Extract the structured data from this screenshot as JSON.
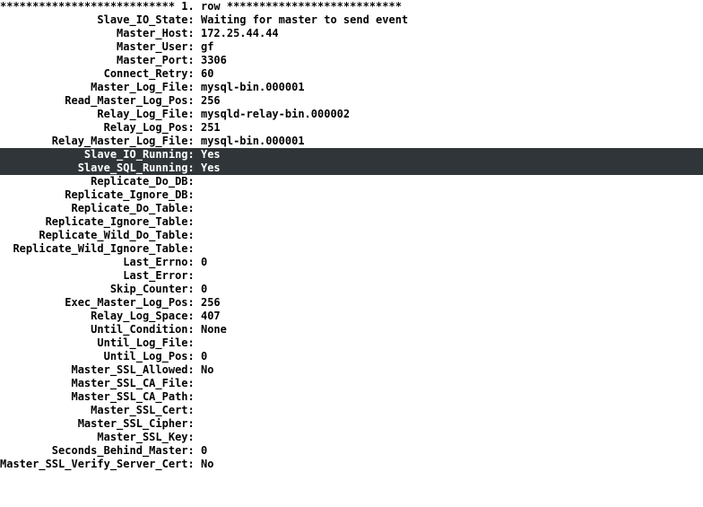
{
  "header": "*************************** 1. row ***************************",
  "labelWidth": 29,
  "highlight": [
    "Slave_IO_Running",
    "Slave_SQL_Running"
  ],
  "fields": [
    {
      "k": "Slave_IO_State",
      "v": "Waiting for master to send event"
    },
    {
      "k": "Master_Host",
      "v": "172.25.44.44"
    },
    {
      "k": "Master_User",
      "v": "gf"
    },
    {
      "k": "Master_Port",
      "v": "3306"
    },
    {
      "k": "Connect_Retry",
      "v": "60"
    },
    {
      "k": "Master_Log_File",
      "v": "mysql-bin.000001"
    },
    {
      "k": "Read_Master_Log_Pos",
      "v": "256"
    },
    {
      "k": "Relay_Log_File",
      "v": "mysqld-relay-bin.000002"
    },
    {
      "k": "Relay_Log_Pos",
      "v": "251"
    },
    {
      "k": "Relay_Master_Log_File",
      "v": "mysql-bin.000001"
    },
    {
      "k": "Slave_IO_Running",
      "v": "Yes"
    },
    {
      "k": "Slave_SQL_Running",
      "v": "Yes"
    },
    {
      "k": "Replicate_Do_DB",
      "v": ""
    },
    {
      "k": "Replicate_Ignore_DB",
      "v": ""
    },
    {
      "k": "Replicate_Do_Table",
      "v": ""
    },
    {
      "k": "Replicate_Ignore_Table",
      "v": ""
    },
    {
      "k": "Replicate_Wild_Do_Table",
      "v": ""
    },
    {
      "k": "Replicate_Wild_Ignore_Table",
      "v": ""
    },
    {
      "k": "Last_Errno",
      "v": "0"
    },
    {
      "k": "Last_Error",
      "v": ""
    },
    {
      "k": "Skip_Counter",
      "v": "0"
    },
    {
      "k": "Exec_Master_Log_Pos",
      "v": "256"
    },
    {
      "k": "Relay_Log_Space",
      "v": "407"
    },
    {
      "k": "Until_Condition",
      "v": "None"
    },
    {
      "k": "Until_Log_File",
      "v": ""
    },
    {
      "k": "Until_Log_Pos",
      "v": "0"
    },
    {
      "k": "Master_SSL_Allowed",
      "v": "No"
    },
    {
      "k": "Master_SSL_CA_File",
      "v": ""
    },
    {
      "k": "Master_SSL_CA_Path",
      "v": ""
    },
    {
      "k": "Master_SSL_Cert",
      "v": ""
    },
    {
      "k": "Master_SSL_Cipher",
      "v": ""
    },
    {
      "k": "Master_SSL_Key",
      "v": ""
    },
    {
      "k": "Seconds_Behind_Master",
      "v": "0"
    },
    {
      "k": "Master_SSL_Verify_Server_Cert",
      "v": "No"
    }
  ]
}
